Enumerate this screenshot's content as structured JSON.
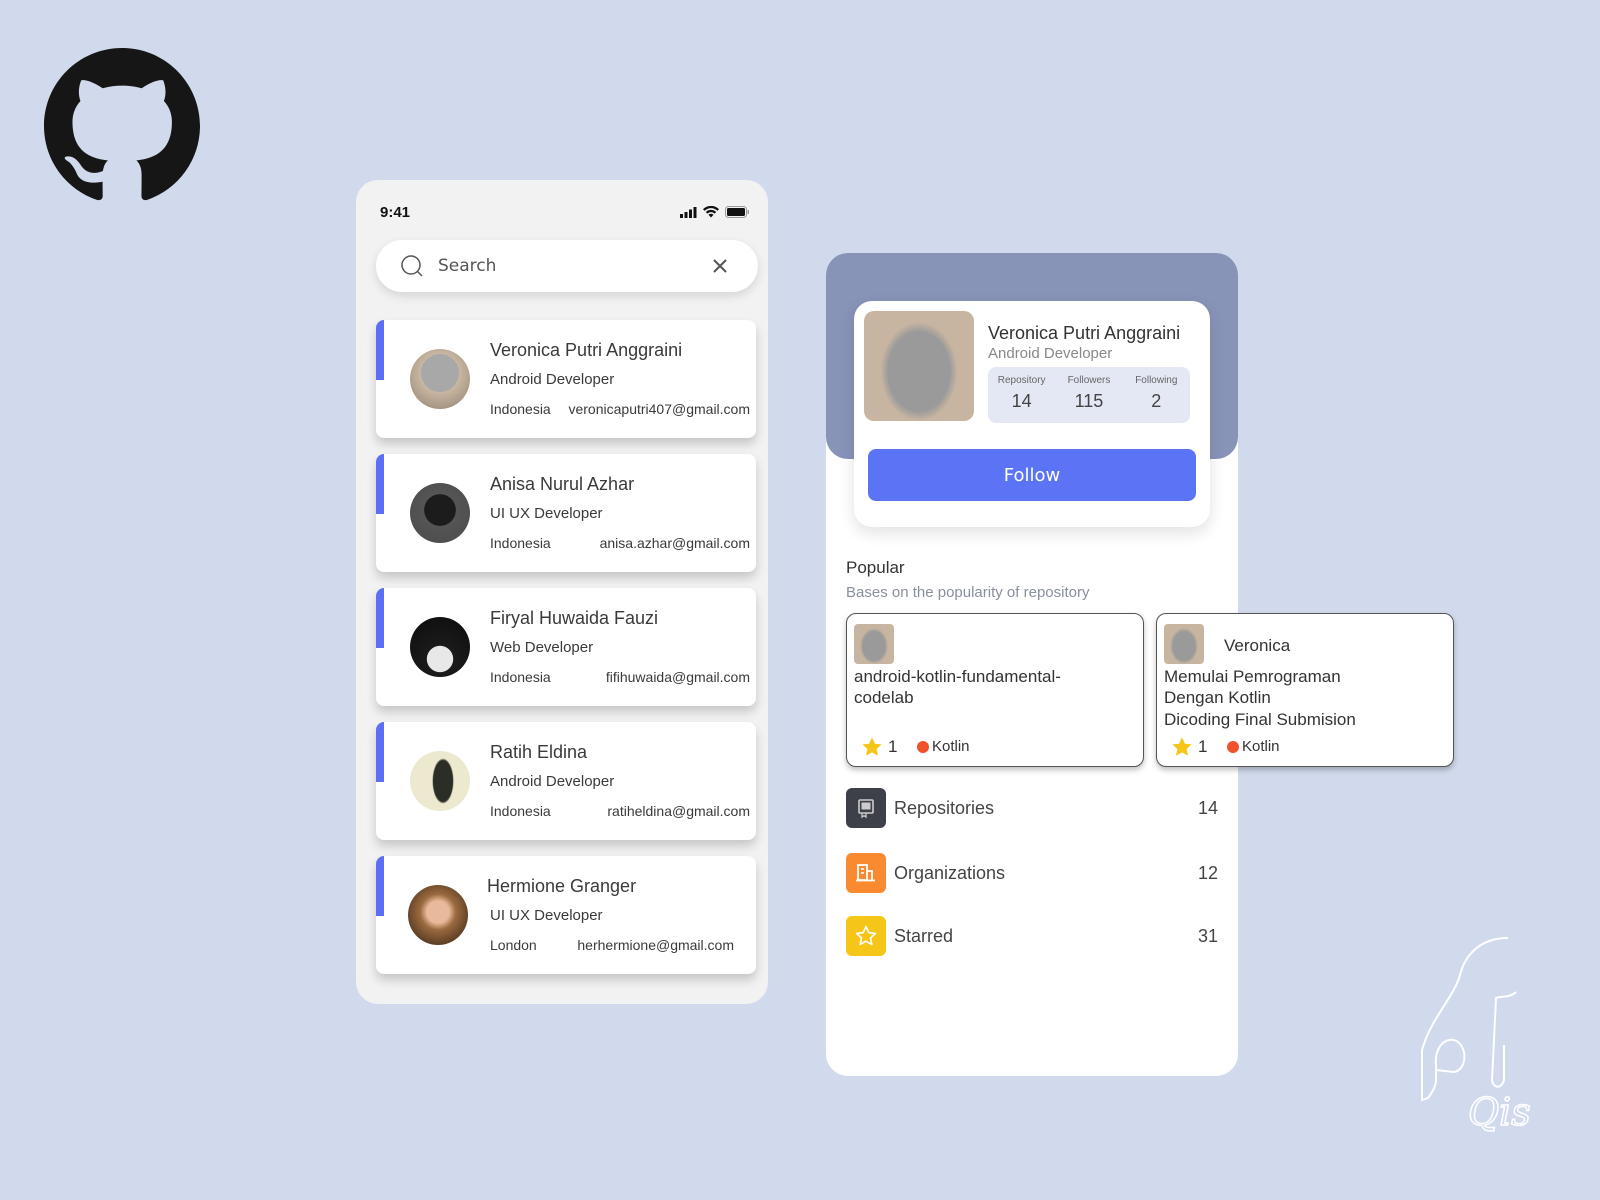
{
  "brand": {
    "logo": "github-octocat-icon",
    "signature": "Qis"
  },
  "colors": {
    "background": "#d1daec",
    "accent": "#5b6ef5",
    "follow": "#5b73f5",
    "header": "#8794b8",
    "kotlin_dot": "#f0522b",
    "repo_icon_bg": "#3d4049",
    "org_icon_bg": "#f98a2f",
    "star_icon_bg": "#f5c518"
  },
  "search_screen": {
    "status": {
      "time": "9:41",
      "icons": [
        "signal-icon",
        "wifi-icon",
        "battery-icon"
      ]
    },
    "search": {
      "placeholder": "Search",
      "value": ""
    },
    "users": [
      {
        "name": "Veronica Putri Anggraini",
        "role": "Android Developer",
        "country": "Indonesia",
        "email": "veronicaputri407@gmail.com"
      },
      {
        "name": "Anisa Nurul Azhar",
        "role": "UI UX Developer",
        "country": "Indonesia",
        "email": "anisa.azhar@gmail.com"
      },
      {
        "name": "Firyal Huwaida Fauzi",
        "role": "Web Developer",
        "country": "Indonesia",
        "email": "fifihuwaida@gmail.com"
      },
      {
        "name": "Ratih Eldina",
        "role": "Android Developer",
        "country": "Indonesia",
        "email": "ratiheldina@gmail.com"
      },
      {
        "name": "Hermione Granger",
        "role": "UI UX Developer",
        "country": "London",
        "email": "herhermione@gmail.com"
      }
    ]
  },
  "profile_screen": {
    "name": "Veronica Putri Anggraini",
    "role": "Android Developer",
    "stats": [
      {
        "label": "Repository",
        "value": "14"
      },
      {
        "label": "Followers",
        "value": "115"
      },
      {
        "label": "Following",
        "value": "2"
      }
    ],
    "follow_label": "Follow",
    "popular": {
      "title": "Popular",
      "subtitle": "Bases on the popularity of repository",
      "repos": [
        {
          "owner": "",
          "title": "android-kotlin-fundamental-codelab",
          "description": "",
          "stars": "1",
          "language": "Kotlin"
        },
        {
          "owner": "Veronica",
          "title": "Memulai Pemrograman Dengan Kotlin",
          "description": "Dicoding Final Submision",
          "stars": "1",
          "language": "Kotlin"
        }
      ]
    },
    "menu": [
      {
        "label": "Repositories",
        "count": "14",
        "icon": "repository-icon"
      },
      {
        "label": "Organizations",
        "count": "12",
        "icon": "organization-icon"
      },
      {
        "label": "Starred",
        "count": "31",
        "icon": "star-icon"
      }
    ]
  }
}
